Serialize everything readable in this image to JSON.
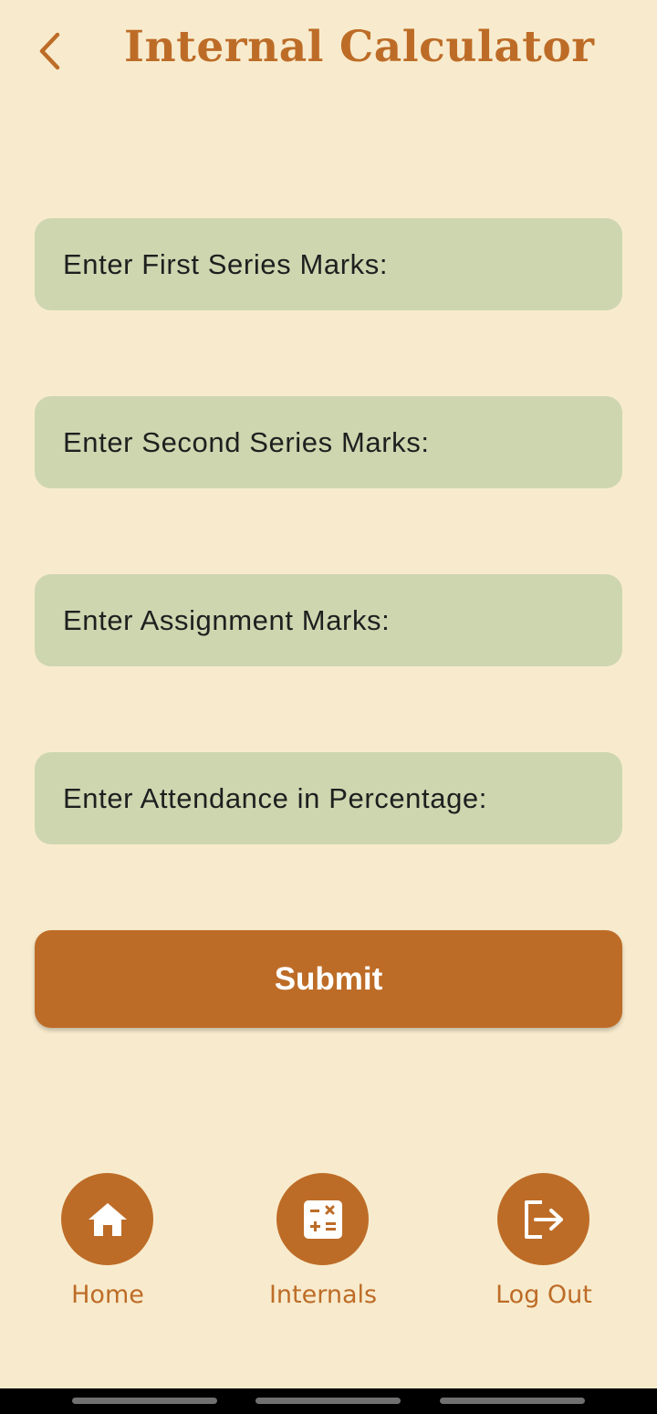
{
  "colors": {
    "background": "#F8EBCD",
    "accent": "#BD6C27",
    "field_background": "#CED6B0",
    "field_text": "#1F1F1F",
    "button_text": "#FFFFFF"
  },
  "header": {
    "back_icon": "chevron-left-icon",
    "title": "Internal Calculator"
  },
  "form": {
    "fields": [
      {
        "placeholder": "Enter First Series Marks:"
      },
      {
        "placeholder": "Enter Second Series Marks:"
      },
      {
        "placeholder": "Enter Assignment Marks:"
      },
      {
        "placeholder": "Enter Attendance in Percentage:"
      }
    ],
    "submit_label": "Submit"
  },
  "bottom_nav": {
    "items": [
      {
        "label": "Home",
        "icon": "home-icon"
      },
      {
        "label": "Internals",
        "icon": "calculator-icon"
      },
      {
        "label": "Log Out",
        "icon": "logout-icon"
      }
    ]
  }
}
